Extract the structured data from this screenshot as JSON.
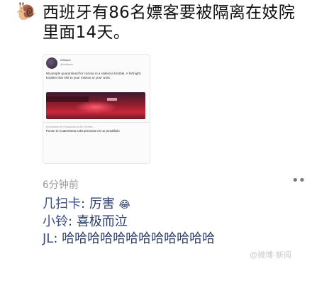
{
  "post": {
    "author_emoji": "🐌",
    "text": "西班牙有86名嫖客要被隔离在妓院里面14天。",
    "timestamp": "6分钟前",
    "more_label": "••"
  },
  "shared_card": {
    "username": "Whiland",
    "handle": "@whiland",
    "tweet_text": "86 people quarantined for corona in a Valencia brothel. A fortnight. Explain that shit to your missus or your work.",
    "link_source": "Encontrado en Pucicuculo.es 86 Clientes ...",
    "link_title": "Ponen en cuarentena a 86 personas en un prostíbulo"
  },
  "comments": [
    {
      "name": "几扫卡",
      "separator": ":",
      "text": "厉害",
      "emoji": "😂"
    },
    {
      "name": "小铃",
      "separator": ":",
      "text": "喜极而泣",
      "emoji": ""
    },
    {
      "name": "JL",
      "separator": ":",
      "text": "哈哈哈哈哈哈哈哈哈哈哈哈",
      "emoji": ""
    }
  ],
  "watermark": "@微博·新闻"
}
